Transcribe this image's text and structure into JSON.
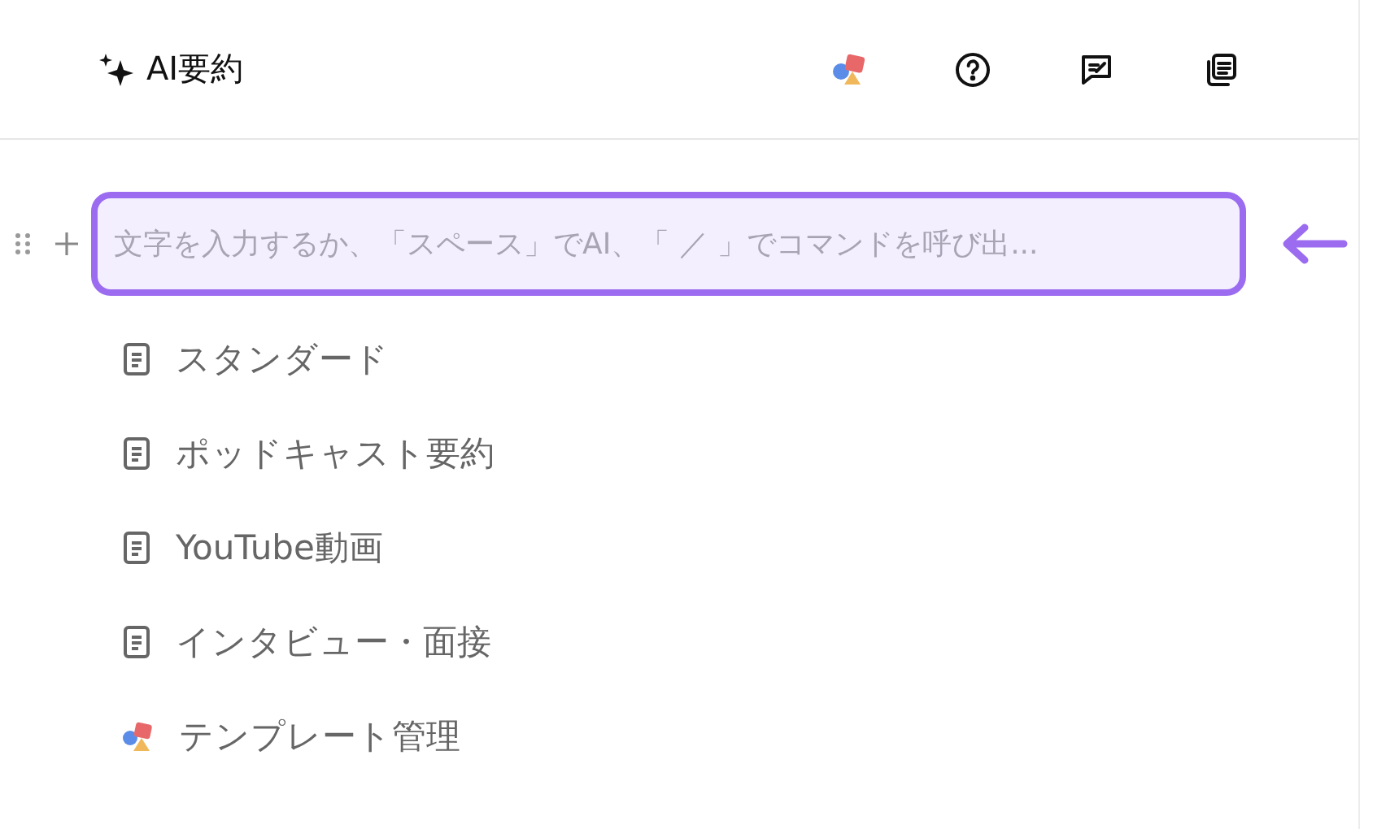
{
  "header": {
    "title": "AI要約"
  },
  "editor": {
    "placeholder": "文字を入力するか、「スペース」でAI、「 ／ 」でコマンドを呼び出..."
  },
  "items": [
    {
      "label": "スタンダード",
      "kind": "document"
    },
    {
      "label": "ポッドキャスト要約",
      "kind": "document"
    },
    {
      "label": "YouTube動画",
      "kind": "document"
    },
    {
      "label": "インタビュー・面接",
      "kind": "document"
    },
    {
      "label": "テンプレート管理",
      "kind": "shapes"
    }
  ]
}
